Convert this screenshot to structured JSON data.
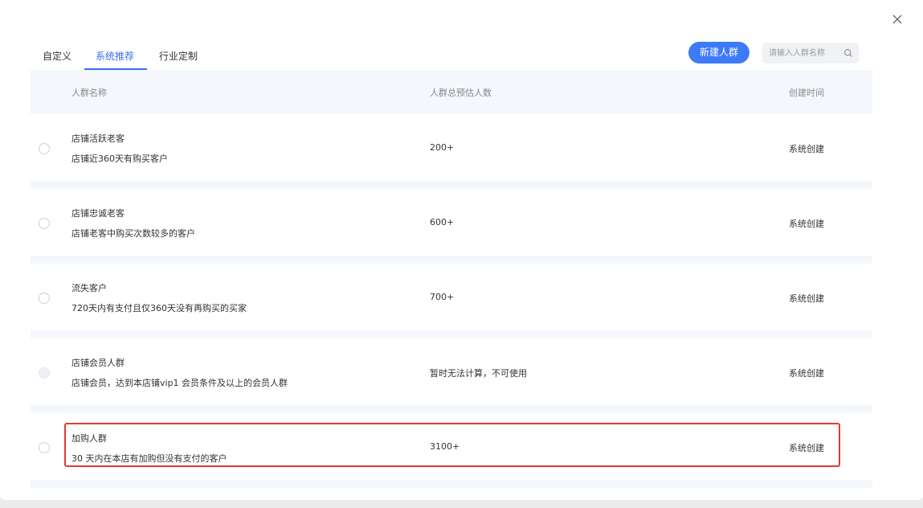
{
  "tabs": [
    {
      "label": "自定义"
    },
    {
      "label": "系统推荐"
    },
    {
      "label": "行业定制"
    }
  ],
  "new_button_label": "新建人群",
  "search": {
    "placeholder": "请输入人群名称"
  },
  "table": {
    "headers": {
      "name": "人群名称",
      "count": "人群总预估人数",
      "created": "创建时间"
    },
    "rows": [
      {
        "name": "店铺活跃老客",
        "desc": "店铺近360天有购买客户",
        "count": "200+",
        "created": "系统创建"
      },
      {
        "name": "店铺忠诚老客",
        "desc": "店铺老客中购买次数较多的客户",
        "count": "600+",
        "created": "系统创建"
      },
      {
        "name": "流失客户",
        "desc": "720天内有支付且仅360天没有再购买的买家",
        "count": "700+",
        "created": "系统创建"
      },
      {
        "name": "店铺会员人群",
        "desc": "店铺会员，达到本店铺vip1 会员条件及以上的会员人群",
        "count": "暂时无法计算，不可使用",
        "created": "系统创建"
      },
      {
        "name": "加购人群",
        "desc": "30 天内在本店有加购但没有支付的客户",
        "count": "3100+",
        "created": "系统创建"
      }
    ]
  },
  "colors": {
    "accent": "#3a6cf3",
    "highlight": "#e53935"
  },
  "icons": {
    "close": "close-icon",
    "search": "search-icon"
  }
}
